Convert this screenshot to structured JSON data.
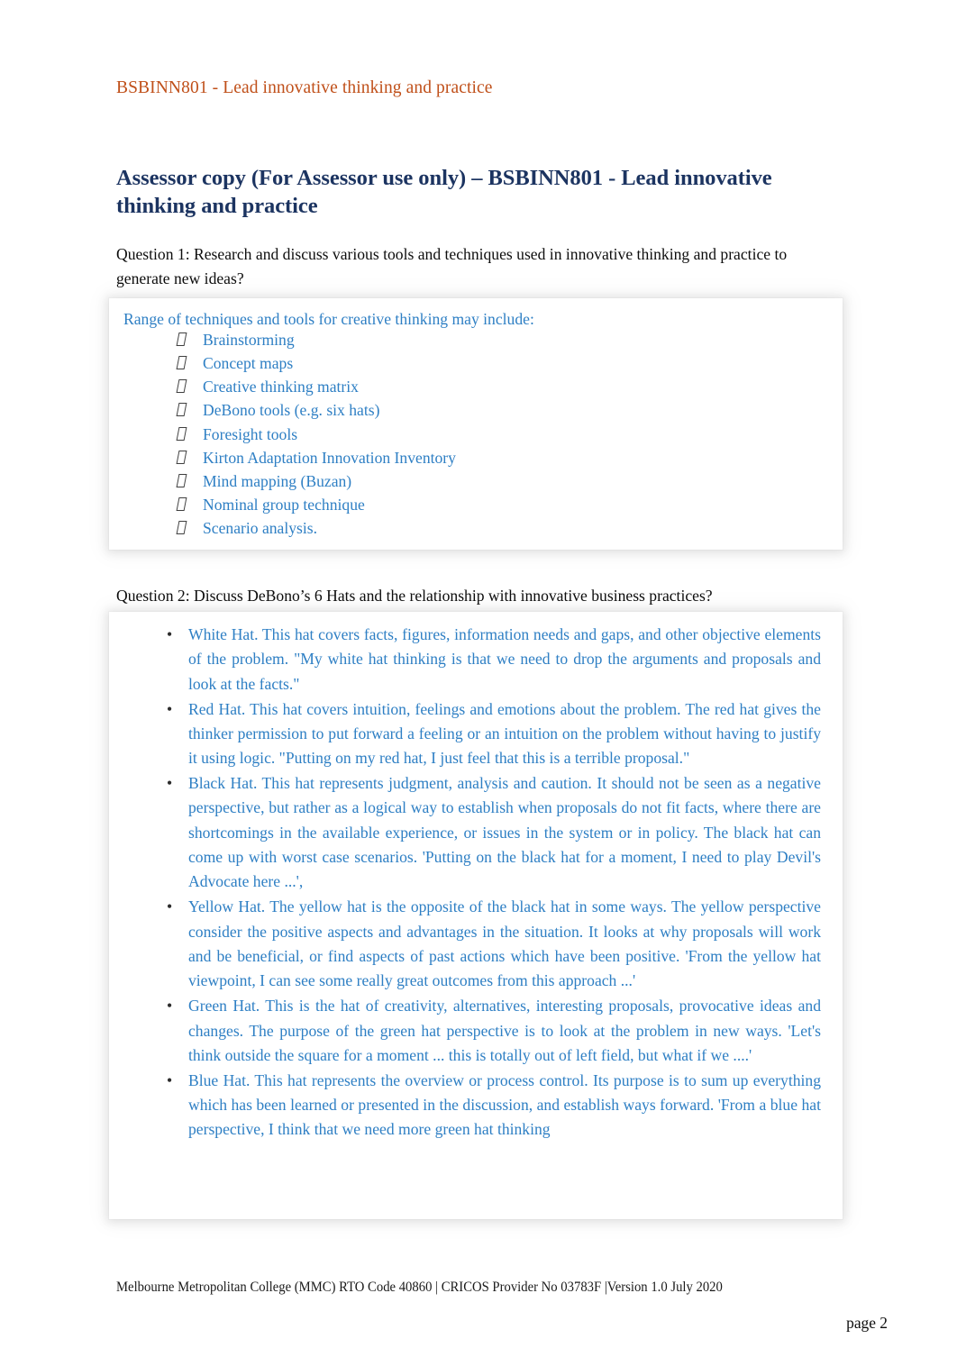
{
  "header": {
    "running_title": "BSBINN801 - Lead innovative thinking and practice"
  },
  "title": {
    "text": "Assessor copy (For Assessor use only) – BSBINN801 - Lead innovative thinking and practice"
  },
  "questions": [
    {
      "prompt": "Question 1: Research and discuss various tools and techniques used in innovative thinking and practice to generate new ideas?",
      "answer": {
        "lead": "Range of techniques and tools for creative thinking may include:",
        "bullet_glyph": "tofu-box",
        "items": [
          "Brainstorming",
          "Concept maps",
          "Creative thinking matrix",
          "DeBono tools (e.g. six hats)",
          "Foresight tools",
          "Kirton Adaptation Innovation Inventory",
          "Mind mapping (Buzan)",
          "Nominal group technique",
          "Scenario analysis."
        ]
      }
    },
    {
      "prompt": "Question 2: Discuss DeBono’s 6 Hats and the relationship with innovative business practices?",
      "answer": {
        "bullet_glyph": "•",
        "items": [
          "White Hat. This hat covers facts, figures, information needs and gaps, and other objective elements of the problem.    \"My white hat thinking is that we need to drop the arguments and proposals and look at the facts.\"",
          "Red Hat. This hat covers intuition, feelings and emotions about the problem. The red hat gives the thinker permission to put forward a feeling or an intuition on the problem without having to justify it using logic. \"Putting on my red hat, I just feel that this is a terrible proposal.\"",
          "Black Hat. This hat represents judgment, analysis and caution. It should not be seen as a negative perspective, but rather as a logical way to establish when proposals do not fit facts, where there are shortcomings in the available experience, or issues in the system or in policy. The black hat can come up with worst case scenarios. 'Putting on the black hat for a moment, I need to play Devil's Advocate here ...',",
          "Yellow Hat. The yellow hat is the opposite of the black hat in some ways. The yellow perspective consider the positive aspects and advantages in the situation. It looks at why proposals will work and be beneficial, or find aspects of past actions which have been positive. 'From the yellow hat viewpoint, I can see some really great outcomes from this approach ...'",
          "Green Hat. This is the hat of creativity, alternatives, interesting proposals, provocative ideas and changes. The purpose of the green hat perspective is to look at the problem in new ways. 'Let's think outside the square for a moment ... this is totally out of left field, but what if we  ....'",
          "Blue Hat. This hat represents the overview or process control. Its purpose is to sum up everything which has been learned or presented in the discussion, and establish ways forward. 'From a blue hat perspective, I think that we need more green hat thinking"
        ]
      }
    }
  ],
  "footer": {
    "text": "Melbourne Metropolitan College (MMC) RTO Code 40860 | CRICOS Provider No 03783F |Version 1.0 July 2020",
    "page_label": "page 2"
  },
  "colors": {
    "header_orange": "#C0501A",
    "title_navy": "#1C3461",
    "answer_blue": "#2E7FC4",
    "body_black": "#0d0d0d"
  }
}
